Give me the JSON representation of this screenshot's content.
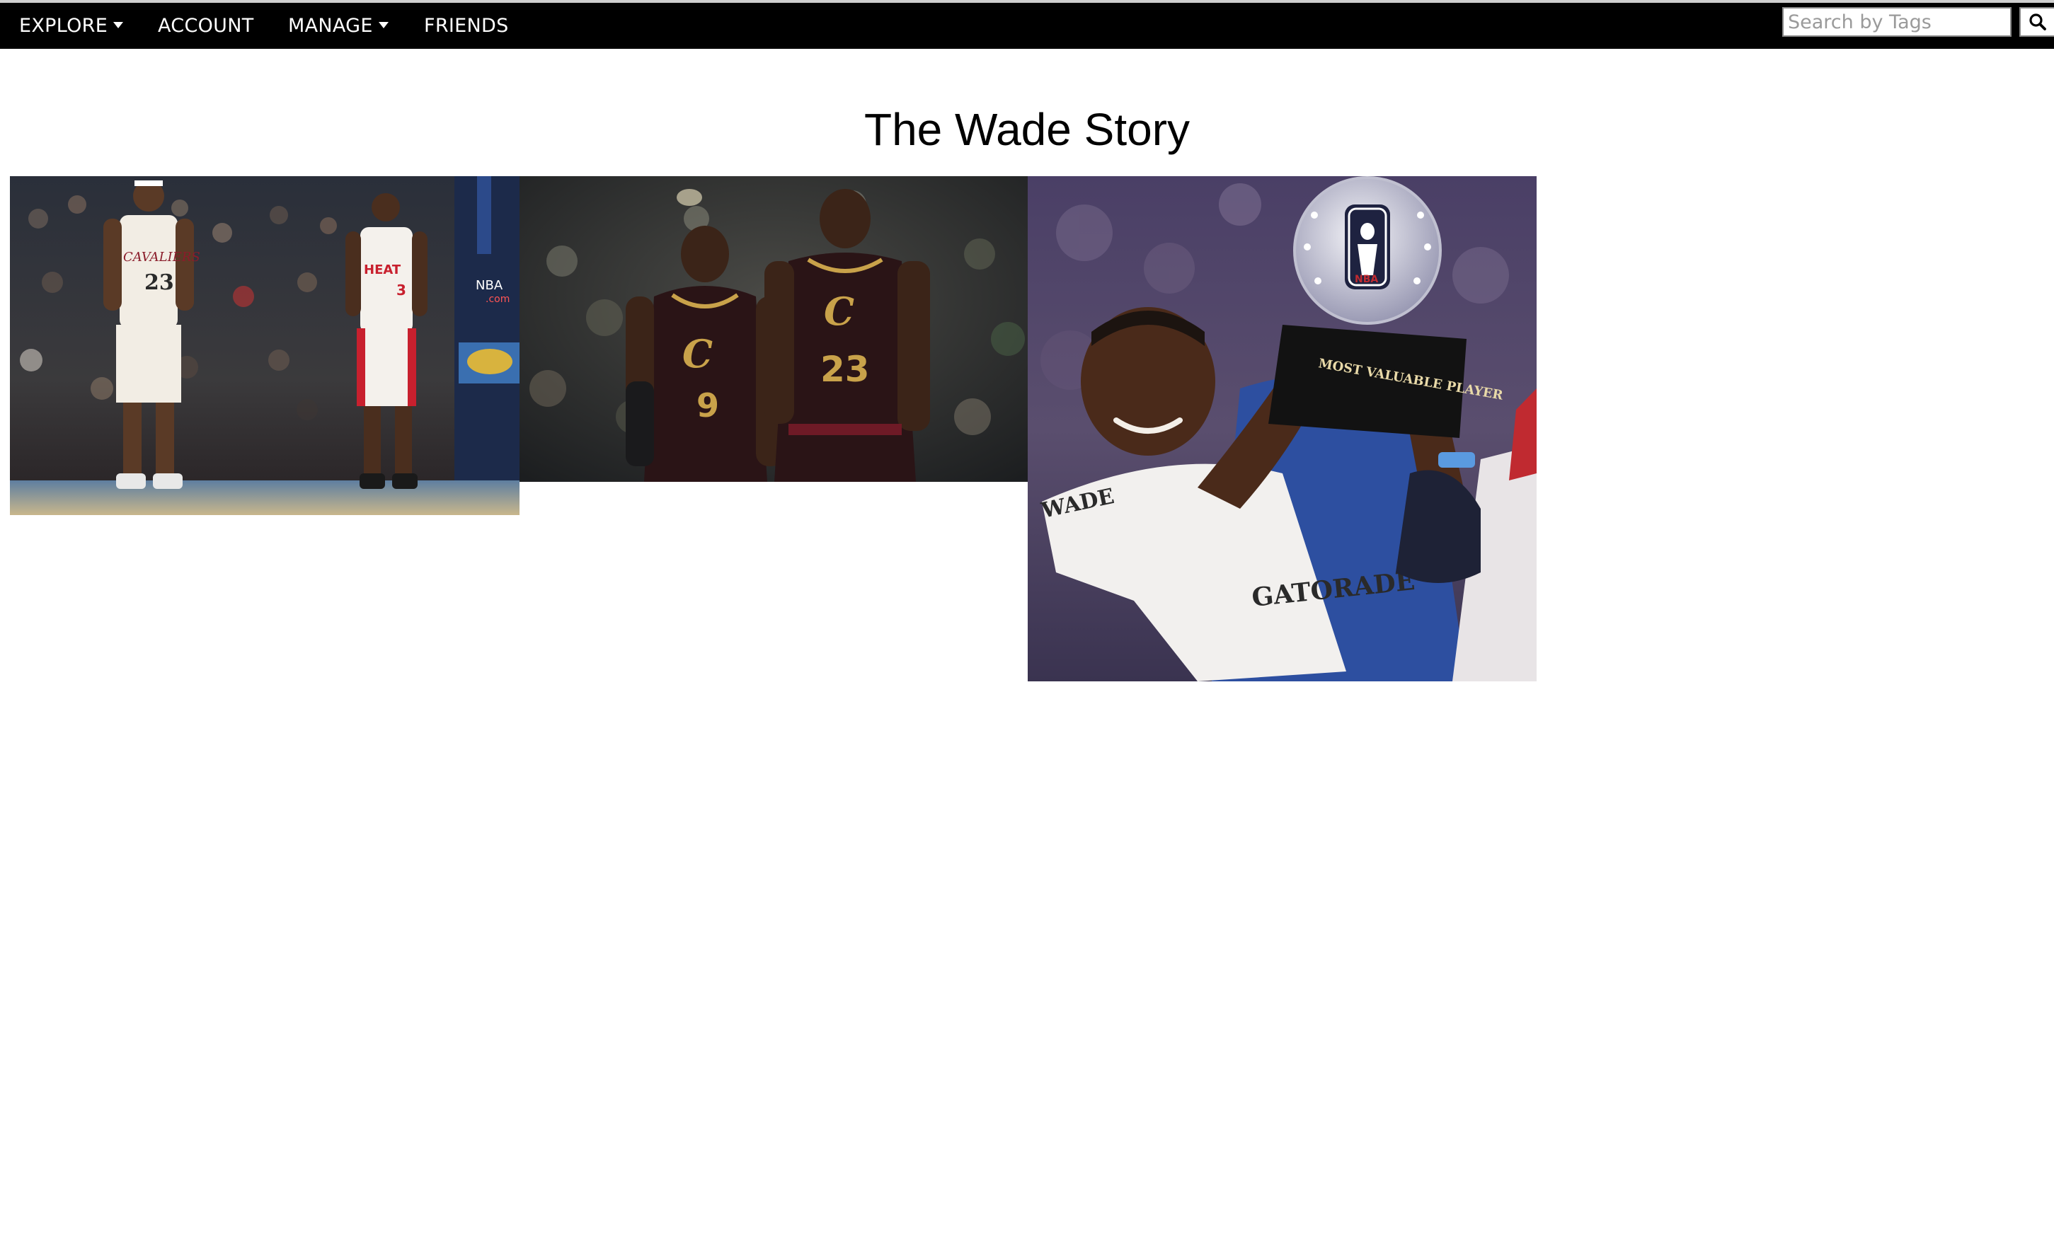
{
  "nav": {
    "explore_label": "EXPLORE",
    "account_label": "ACCOUNT",
    "manage_label": "MANAGE",
    "friends_label": "FRIENDS"
  },
  "search": {
    "placeholder": "Search by Tags"
  },
  "page": {
    "title": "The Wade Story"
  },
  "photos": [
    {
      "jersey_left": "23",
      "jersey_right": "3",
      "team_left": "CAVALIERS",
      "team_right": "HEAT"
    },
    {
      "jersey_left": "9",
      "jersey_right": "23"
    },
    {
      "trophy_text": "MOST VALUABLE PLAYER",
      "towel_text": "GATORADE",
      "shirt_text": "WADE"
    }
  ],
  "colors": {
    "navbar": "#000000",
    "nav_text": "#ffffff",
    "background": "#ffffff"
  }
}
